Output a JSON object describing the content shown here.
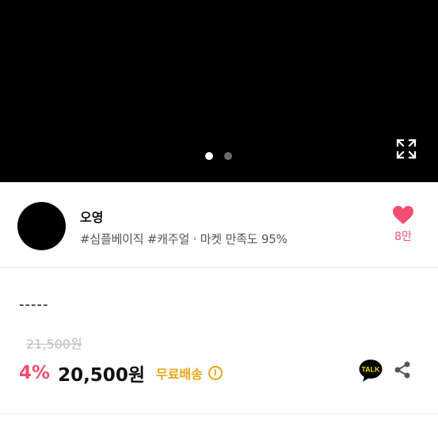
{
  "carousel": {
    "active_index": 0,
    "total": 2,
    "expand_icon": "expand-icon"
  },
  "shop": {
    "name": "오영",
    "meta": "#심플베이직 #캐주얼 · 마켓 만족도 95%",
    "like_icon": "heart-icon",
    "like_count": "8만"
  },
  "product": {
    "title": "-----",
    "original_price": "21,500원",
    "discount": "4%",
    "price": "20,500원",
    "shipping": "무료배송",
    "info_icon": "info-icon",
    "talk_icon": "kakao-talk-icon",
    "talk_label": "TALK",
    "share_icon": "share-icon"
  },
  "colors": {
    "accent_pink": "#f0506e",
    "shipping_yellow": "#e7a51a",
    "talk_bubble": "#000000",
    "talk_text": "#f7d900"
  }
}
